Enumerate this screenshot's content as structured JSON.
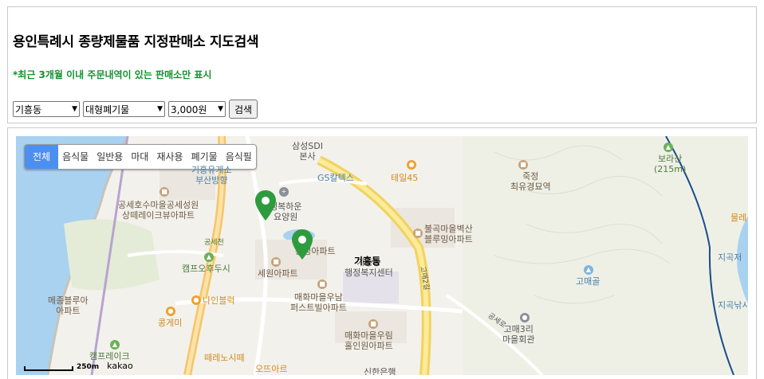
{
  "header": {
    "title": "용인특례시 종량제물품 지정판매소 지도검색",
    "notice": "*최근 3개월 이내 주문내역이 있는 판매소만 표시"
  },
  "filters": {
    "dong": "기흥동",
    "item_type": "대형폐기물",
    "price": "3,000원",
    "search_label": "검색"
  },
  "map": {
    "categories": [
      "전체",
      "음식물",
      "일반용",
      "마대",
      "재사용",
      "폐기물",
      "음식필"
    ],
    "active_category": "전체",
    "region_label": "기흥동",
    "places": {
      "samsung_sdi": "삼성SDI\n본사",
      "gs_caltex": "GS칼텍스",
      "teil45": "테일45",
      "bus_gate": "기흥유게소\n부산방향",
      "gongse_apt": "공세호수마을공세성원\n상떼레이크뷰아파트",
      "haengbok": "행복하운\n요양원",
      "bulgok_apt": "불곡마을벽산\n블루밍아파트",
      "gongsecheon": "공세천",
      "camp_odusi": "캠프오후두시",
      "dongsung_apt": "동성아파트",
      "seowon_apt": "세원아파트",
      "giheung_center": "기흥동\n행정복지센터",
      "maehwa_first": "매화마을우남\n퍼스트빌아파트",
      "nain": "나인블럭",
      "kongge": "콩게미",
      "mejong_apt": "메종블루아\n아파트",
      "maehwa_urim": "매화마을우림\n홀인원아파트",
      "camp_lake": "캠프레이크",
      "terrace": "떼레노시떼",
      "gomaegol": "고매골",
      "gomae3": "고매3리\n마을회관",
      "jukjeong": "죽정\n최유경묘역",
      "borasan": "보라산\n(215m)",
      "jigok1": "지곡저",
      "jigok2": "지곡낚시",
      "mullae": "물레",
      "sinhan": "신한은행",
      "opera": "오뜨아르",
      "road_2": "고매2길",
      "road_gongse": "공세로"
    }
  },
  "scale": {
    "distance": "250m",
    "provider": "kakao"
  },
  "colors": {
    "notice": "#12922e",
    "active_tab": "#4d8ff0",
    "marker": "#2e9b3e"
  }
}
